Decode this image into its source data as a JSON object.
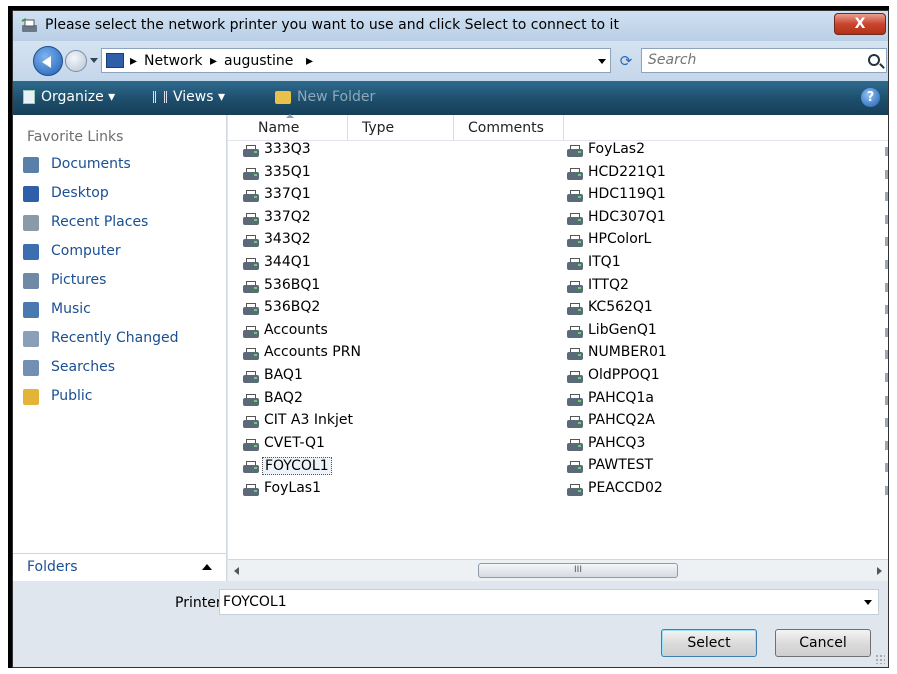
{
  "window": {
    "title": "Please select the network printer you want to use and click Select to connect to it",
    "close_label": "X"
  },
  "address": {
    "crumbs": [
      "Network",
      "augustine"
    ],
    "separator": "▸",
    "search_placeholder": "Search"
  },
  "toolbar": {
    "organize": "Organize",
    "views": "Views",
    "new_folder": "New Folder",
    "help": "?"
  },
  "nav": {
    "title": "Favorite Links",
    "items": [
      {
        "label": "Documents",
        "icon": "documents-icon",
        "color": "#5a7fa8"
      },
      {
        "label": "Desktop",
        "icon": "desktop-icon",
        "color": "#2f5fa8"
      },
      {
        "label": "Recent Places",
        "icon": "recent-places-icon",
        "color": "#8a9aa8"
      },
      {
        "label": "Computer",
        "icon": "computer-icon",
        "color": "#3c6fb0"
      },
      {
        "label": "Pictures",
        "icon": "pictures-icon",
        "color": "#6f8aa4"
      },
      {
        "label": "Music",
        "icon": "music-icon",
        "color": "#4a78b0"
      },
      {
        "label": "Recently Changed",
        "icon": "recently-changed-icon",
        "color": "#8a9fb8"
      },
      {
        "label": "Searches",
        "icon": "searches-icon",
        "color": "#6f8fb4"
      },
      {
        "label": "Public",
        "icon": "public-folder-icon",
        "color": "#e2b43a"
      }
    ],
    "folders_label": "Folders"
  },
  "columns": [
    "Name",
    "Type",
    "Comments"
  ],
  "printers_col1": [
    "333Q3",
    "335Q1",
    "337Q1",
    "337Q2",
    "343Q2",
    "344Q1",
    "536BQ1",
    "536BQ2",
    "Accounts",
    "Accounts PRN",
    "BAQ1",
    "BAQ2",
    "CIT A3 Inkjet",
    "CVET-Q1",
    "FOYCOL1",
    "FoyLas1"
  ],
  "printers_col2": [
    "FoyLas2",
    "HCD221Q1",
    "HDC119Q1",
    "HDC307Q1",
    "HPColorL",
    "ITQ1",
    "ITTQ2",
    "KC562Q1",
    "LibGenQ1",
    "NUMBER01",
    "OldPPOQ1",
    "PAHCQ1a",
    "PAHCQ2A",
    "PAHCQ3",
    "PAWTEST",
    "PEACCD02"
  ],
  "selected_printer": "FOYCOL1",
  "scrollbar_grip": "III",
  "bottom": {
    "printer_label": "Printer",
    "printer_value": "FOYCOL1",
    "select_label": "Select",
    "cancel_label": "Cancel"
  }
}
